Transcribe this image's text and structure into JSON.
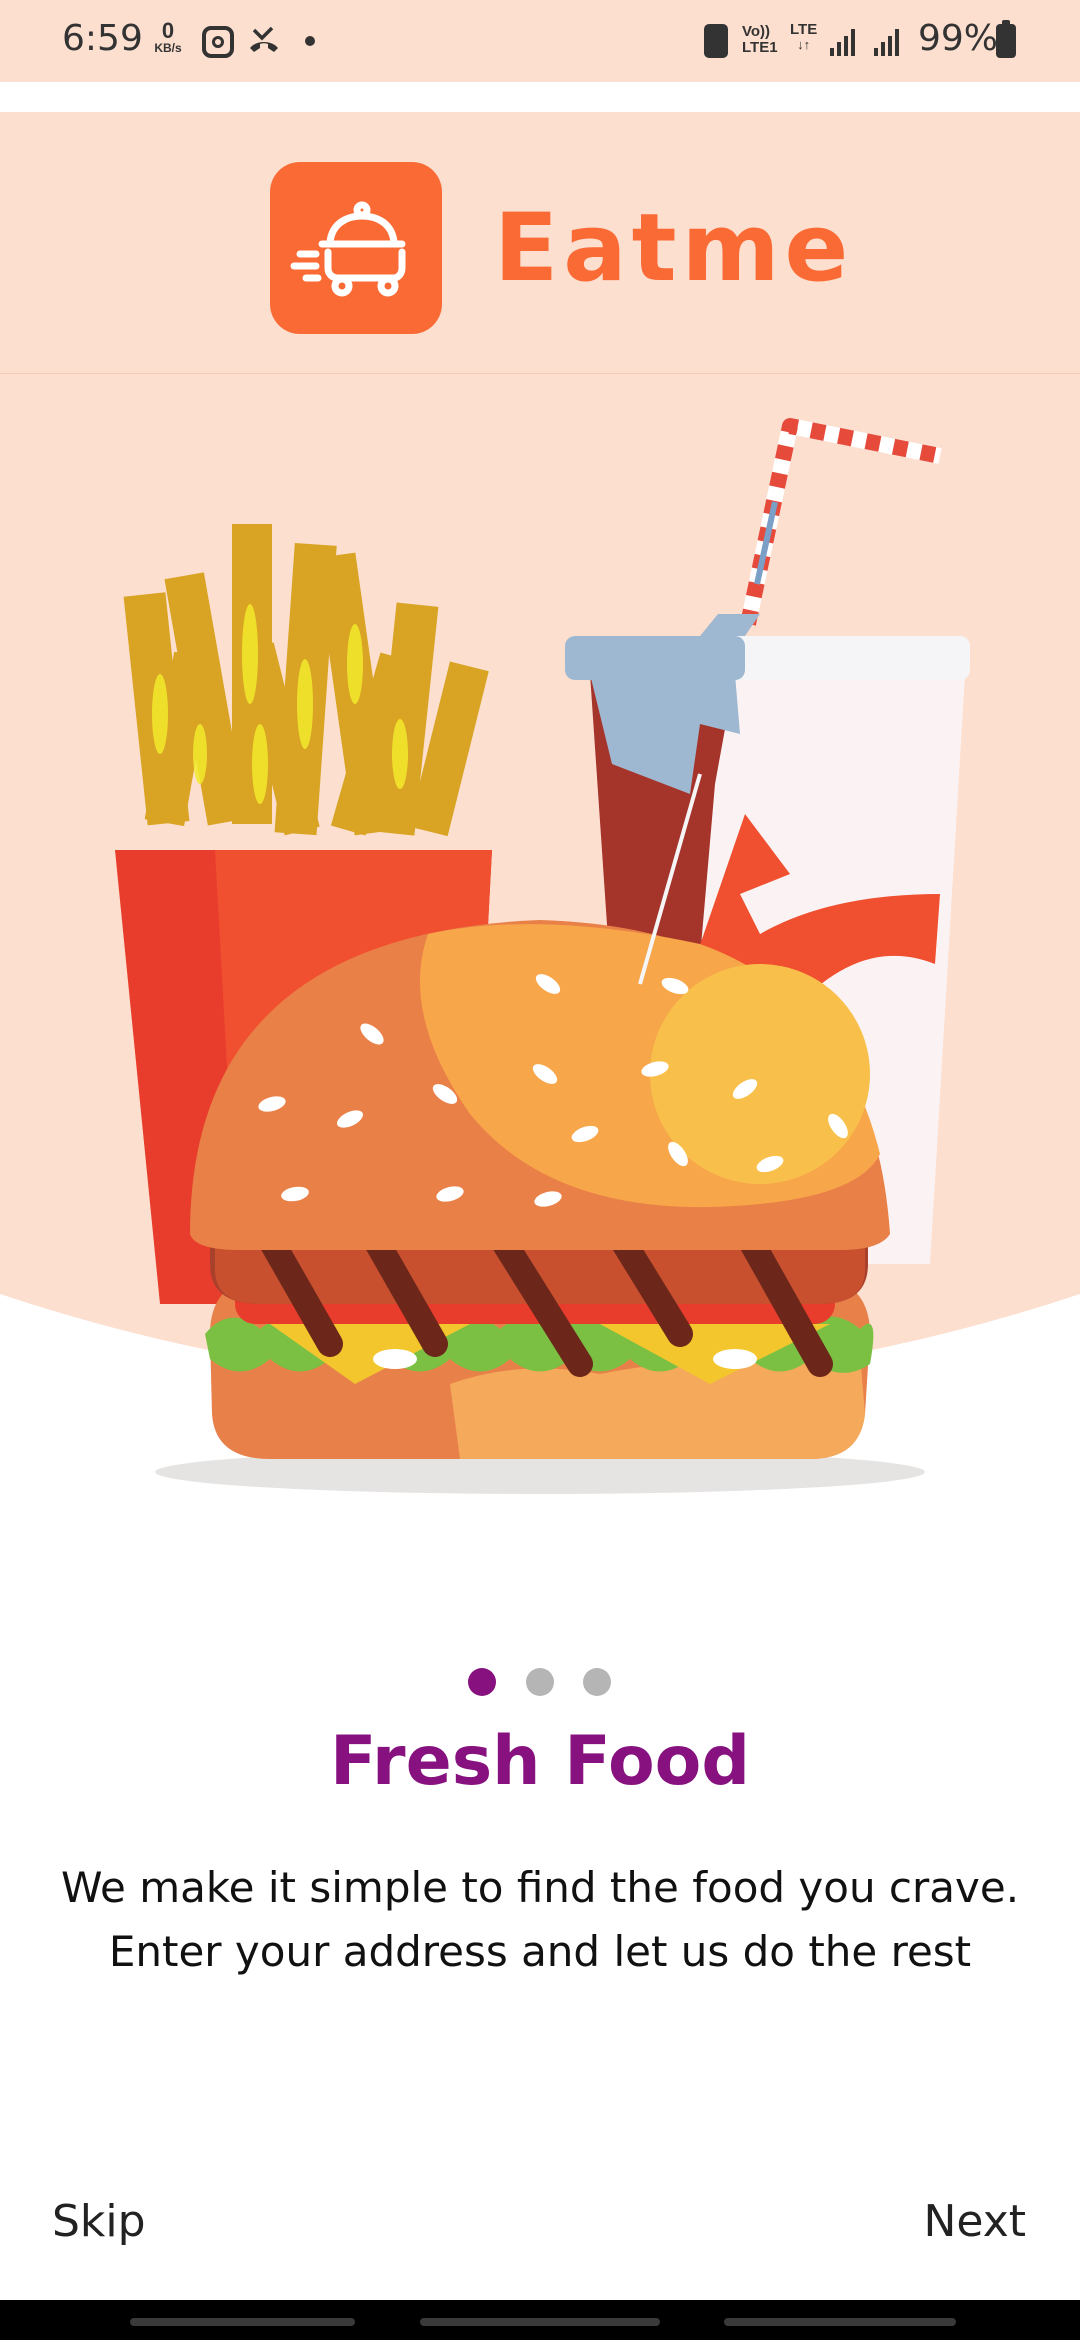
{
  "status_bar": {
    "time": "6:59",
    "net_speed": "0",
    "net_unit": "KB/s",
    "volte_top": "Vo))",
    "volte_bottom": "LTE1",
    "lte_top": "LTE",
    "lte_bottom": "↓↑",
    "battery": "99%",
    "icons": [
      "instagram-icon",
      "missed-call-icon",
      "notification-dot-icon",
      "alarm-icon",
      "signal-icon",
      "battery-icon"
    ]
  },
  "header": {
    "brand_name": "Eatme",
    "brand_color": "#fa6a35",
    "logo_icon": "food-delivery-cart-icon"
  },
  "hero": {
    "illustration": "fries-soda-burger-illustration"
  },
  "onboarding": {
    "total_pages": 3,
    "active_index": 0,
    "active_color": "#86117f",
    "title": "Fresh Food",
    "description_line1": "We make it simple to find the food you crave.",
    "description_line2": "Enter your address and let us do the rest"
  },
  "footer": {
    "skip_label": "Skip",
    "next_label": "Next"
  }
}
